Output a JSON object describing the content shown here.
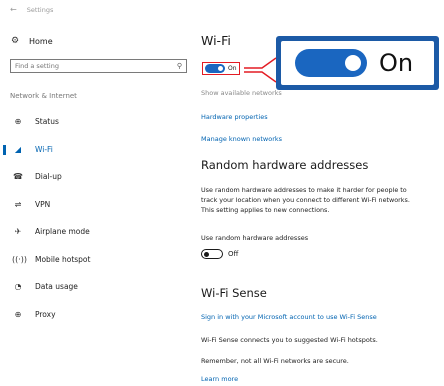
{
  "window": {
    "title": "Settings"
  },
  "sidebar": {
    "home": "Home",
    "search_placeholder": "Find a setting",
    "section": "Network & Internet",
    "items": [
      {
        "label": "Status",
        "icon": "globe-icon",
        "active": false
      },
      {
        "label": "Wi-Fi",
        "icon": "wifi-icon",
        "active": true
      },
      {
        "label": "Dial-up",
        "icon": "dialup-icon",
        "active": false
      },
      {
        "label": "VPN",
        "icon": "vpn-icon",
        "active": false
      },
      {
        "label": "Airplane mode",
        "icon": "airplane-icon",
        "active": false
      },
      {
        "label": "Mobile hotspot",
        "icon": "hotspot-icon",
        "active": false
      },
      {
        "label": "Data usage",
        "icon": "data-usage-icon",
        "active": false
      },
      {
        "label": "Proxy",
        "icon": "proxy-icon",
        "active": false
      }
    ]
  },
  "content": {
    "wifi_title": "Wi-Fi",
    "wifi_toggle_label": "On",
    "show_networks": "Show available networks",
    "hardware_properties": "Hardware properties",
    "manage_networks": "Manage known networks",
    "random_title": "Random hardware addresses",
    "random_para_1": "Use random hardware addresses to make it harder for people to",
    "random_para_2": "track your location when you connect to different Wi-Fi networks.",
    "random_para_3": "This setting applies to new connections.",
    "random_toggle_title": "Use random hardware addresses",
    "random_toggle_label": "Off",
    "sense_title": "Wi-Fi Sense",
    "sense_link": "Sign in with your Microsoft account to use Wi-Fi Sense",
    "sense_para": "Wi-Fi Sense connects you to suggested Wi-Fi hotspots.",
    "sense_remember": "Remember, not all Wi-Fi networks are secure.",
    "learn_more": "Learn more"
  },
  "callout": {
    "label": "On"
  },
  "colors": {
    "accent": "#1a66c0",
    "callout_border": "#1c5aa6",
    "highlight": "#e31b23"
  }
}
